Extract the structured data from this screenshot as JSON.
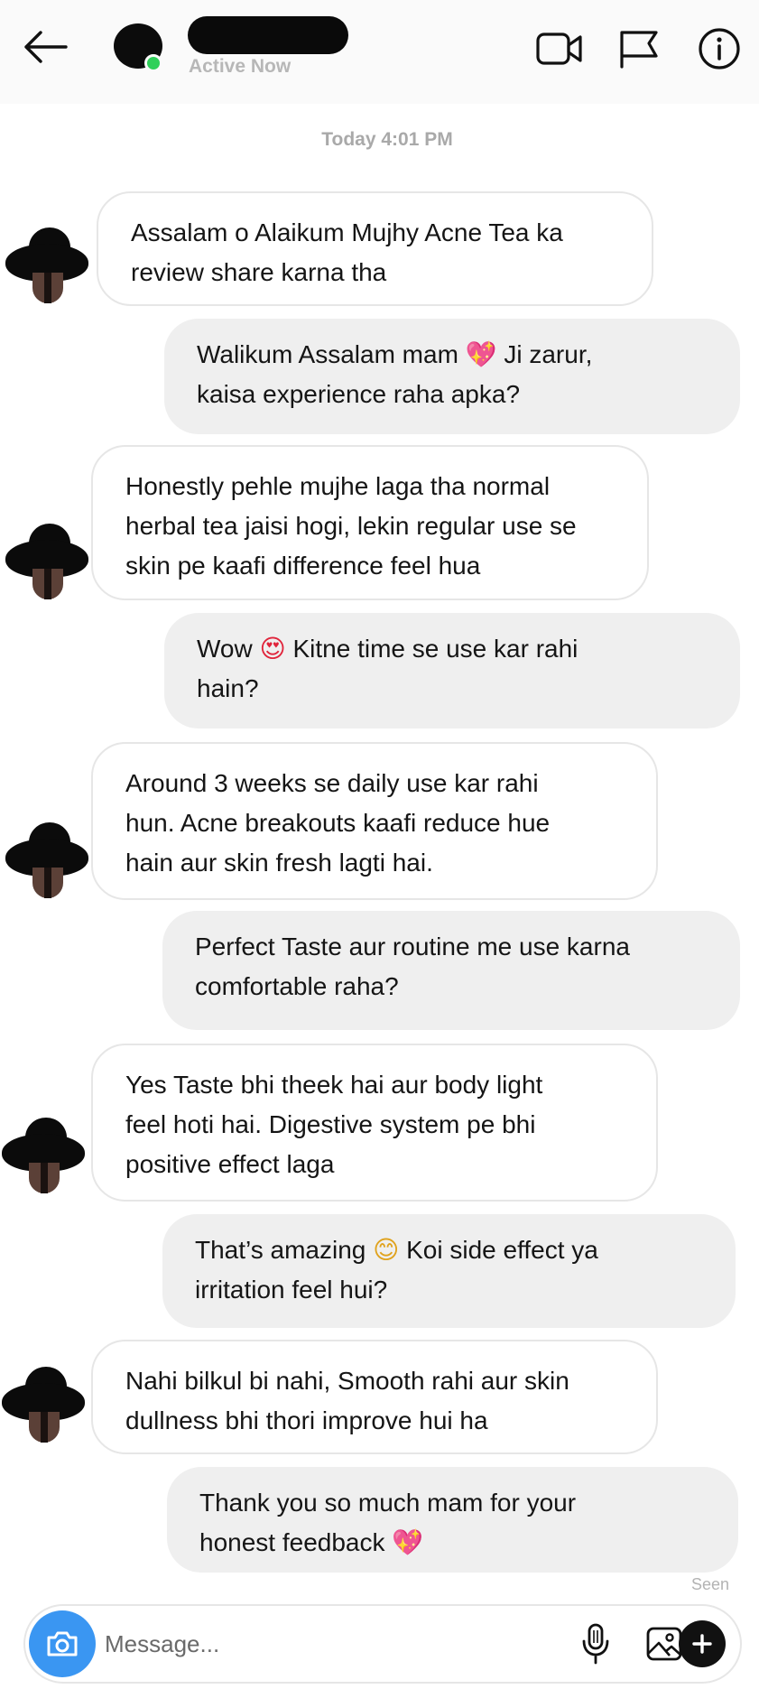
{
  "header": {
    "status": "Active Now",
    "back_icon": "arrow-left-icon",
    "video_icon": "video-camera-icon",
    "flag_icon": "flag-icon",
    "info_icon": "info-icon",
    "online_color": "#2fd05a"
  },
  "timestamp": "Today 4:01 PM",
  "messages": [
    {
      "direction": "incoming",
      "lines": [
        "Assalam o Alaikum Mujhy Acne Tea ka",
        "review share karna tha"
      ]
    },
    {
      "direction": "outgoing",
      "lines": [
        "Walikum Assalam mam",
        "Ji zarur,",
        "kaisa experience raha apka?"
      ],
      "emoji": "💖"
    },
    {
      "direction": "incoming",
      "lines": [
        "Honestly pehle mujhe laga tha normal",
        "herbal tea jaisi hogi, lekin regular use se",
        "skin pe kaafi difference feel hua"
      ]
    },
    {
      "direction": "outgoing",
      "lines": [
        "Wow",
        "Kitne time se use kar rahi",
        "hain?"
      ],
      "emoji": "😍"
    },
    {
      "direction": "incoming",
      "lines": [
        "Around 3 weeks se daily use kar rahi",
        "hun. Acne breakouts kaafi reduce hue",
        "hain aur skin fresh lagti hai."
      ]
    },
    {
      "direction": "outgoing",
      "lines": [
        "Perfect Taste aur routine me use karna",
        "comfortable raha?"
      ]
    },
    {
      "direction": "incoming",
      "lines": [
        "Yes Taste bhi theek hai aur body light",
        "feel hoti hai. Digestive system pe bhi",
        "positive effect laga"
      ]
    },
    {
      "direction": "outgoing",
      "lines": [
        "That’s amazing",
        "Koi side effect ya",
        "irritation feel hui?"
      ],
      "emoji": "😊"
    },
    {
      "direction": "incoming",
      "lines": [
        "Nahi bilkul bi nahi, Smooth rahi aur skin",
        "dullness bhi thori improve hui ha"
      ]
    },
    {
      "direction": "outgoing",
      "lines": [
        "Thank you so much mam for your",
        "honest feedback"
      ],
      "emoji": "💖"
    }
  ],
  "seen_label": "Seen",
  "composer": {
    "placeholder": "Message...",
    "camera_icon": "camera-icon",
    "mic_icon": "microphone-icon",
    "gallery_icon": "image-gallery-icon",
    "add_icon": "plus-icon",
    "camera_color": "#3a96f2"
  }
}
